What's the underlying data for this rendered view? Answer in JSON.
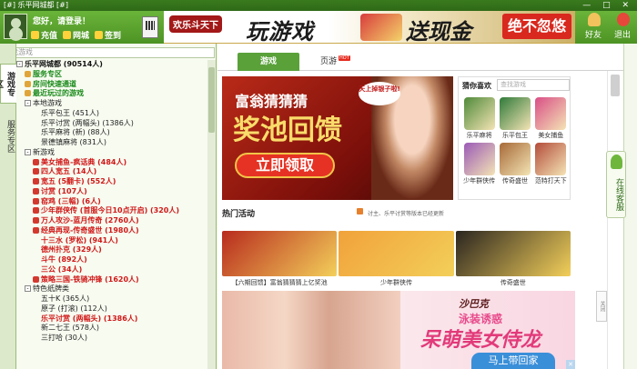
{
  "window": {
    "title": "[#] 乐平网城都 [#]"
  },
  "user": {
    "greeting": "您好，请登录！",
    "buttons": [
      "充值",
      "网城",
      "签到"
    ]
  },
  "banner": {
    "logo": "欢乐斗天下",
    "text_left": "玩游戏",
    "text_right": "送现金",
    "cta": "绝不忽悠"
  },
  "topright": {
    "friends": "好友",
    "exit": "退出"
  },
  "sidebar": {
    "tabs": [
      "游戏专区",
      "服务专区"
    ],
    "search_placeholder": "查找游戏",
    "tree": [
      {
        "text": "乐平网城都 (90514人)",
        "style": "bold",
        "indent": 0,
        "box": "-"
      },
      {
        "text": "服务专区",
        "style": "green",
        "indent": 1,
        "icon": "y"
      },
      {
        "text": "房间快速通道",
        "style": "green",
        "indent": 1,
        "icon": "y"
      },
      {
        "text": "最近玩过的游戏",
        "style": "green",
        "indent": 1,
        "icon": "y"
      },
      {
        "text": "本地游戏",
        "style": "dark",
        "indent": 1,
        "box": "-"
      },
      {
        "text": "乐平包王 (451人)",
        "style": "dark",
        "indent": 3
      },
      {
        "text": "乐平讨赏 (两幅头) (1386人)",
        "style": "dark",
        "indent": 3
      },
      {
        "text": "乐平麻将 (新) (88人)",
        "style": "dark",
        "indent": 3
      },
      {
        "text": "景德镇麻将 (831人)",
        "style": "dark",
        "indent": 3
      },
      {
        "text": "新游戏",
        "style": "dark",
        "indent": 1,
        "box": "-"
      },
      {
        "text": "美女捕鱼-疯话典 (484人)",
        "style": "red",
        "indent": 2,
        "icon": "r"
      },
      {
        "text": "四人宽五 (14人)",
        "style": "red",
        "indent": 2,
        "icon": "r"
      },
      {
        "text": "宽五 (5翻卡) (552人)",
        "style": "red",
        "indent": 2,
        "icon": "r"
      },
      {
        "text": "讨赏 (107人)",
        "style": "red",
        "indent": 2,
        "icon": "r"
      },
      {
        "text": "窑鸡 (三幅) (6人)",
        "style": "red",
        "indent": 2,
        "icon": "r"
      },
      {
        "text": "少年群侠传 (首服今日10点开启) (320人)",
        "style": "red",
        "indent": 2,
        "icon": "r"
      },
      {
        "text": "万人攻沙-蓝月传奇 (2760人)",
        "style": "red",
        "indent": 2,
        "icon": "r"
      },
      {
        "text": "经典再现-传奇盛世 (1980人)",
        "style": "red",
        "indent": 2,
        "icon": "r"
      },
      {
        "text": "十三水 (罗松) (941人)",
        "style": "red",
        "indent": 3
      },
      {
        "text": "德州扑克 (329人)",
        "style": "red",
        "indent": 3
      },
      {
        "text": "斗牛 (892人)",
        "style": "red",
        "indent": 3
      },
      {
        "text": "三公 (34人)",
        "style": "red",
        "indent": 3
      },
      {
        "text": "策略三国-铁骑冲锋 (1620人)",
        "style": "red",
        "indent": 2,
        "icon": "r"
      },
      {
        "text": "特色纸牌类",
        "style": "dark",
        "indent": 1,
        "box": "-"
      },
      {
        "text": "五十K (365人)",
        "style": "dark",
        "indent": 3
      },
      {
        "text": "原子 (打滚) (112人)",
        "style": "dark",
        "indent": 3
      },
      {
        "text": "乐平讨赏 (两幅头) (1386人)",
        "style": "red",
        "indent": 3
      },
      {
        "text": "新二七王 (578人)",
        "style": "dark",
        "indent": 3
      },
      {
        "text": "三打哈 (30人)",
        "style": "dark",
        "indent": 3
      }
    ]
  },
  "main": {
    "tabs": [
      {
        "label": "游戏"
      },
      {
        "label": "页游",
        "badge": "HOT"
      }
    ],
    "ad1": {
      "line1": "富翁猜猜猜",
      "line2": "奖池回馈",
      "cta": "立即领取",
      "bubble": "天上掉银子啦!"
    },
    "favorites": {
      "title": "猜你喜欢",
      "search_placeholder": "查找游戏",
      "items": [
        {
          "label": "乐平麻将",
          "color": "#4f8a3a"
        },
        {
          "label": "乐平包王",
          "color": "#2f7a3a"
        },
        {
          "label": "美女捕鱼",
          "color": "#d94e86"
        },
        {
          "label": "少年群侠传",
          "color": "#9b5ab7"
        },
        {
          "label": "传奇盛世",
          "color": "#a76a38"
        },
        {
          "label": "范特打天下",
          "color": "#b34c3a"
        }
      ]
    },
    "hot_title": "热门活动",
    "ticker": "讨主、乐平讨赏等版本已经更新",
    "activities": [
      {
        "label": "【六期回馈】富翁猜猜猜上亿奖池",
        "color": "#b82b1e"
      },
      {
        "label": "少年群侠传",
        "color": "#f1a23a"
      },
      {
        "label": "传奇盛世",
        "color": "#2a2520"
      }
    ],
    "ad2": {
      "logo": "沙巴克",
      "line1": "泳装诱惑",
      "line2": "呆萌美女侍龙",
      "cta": "马上带回家"
    },
    "close_ad": "关闭"
  },
  "customer_service": "在线客服"
}
